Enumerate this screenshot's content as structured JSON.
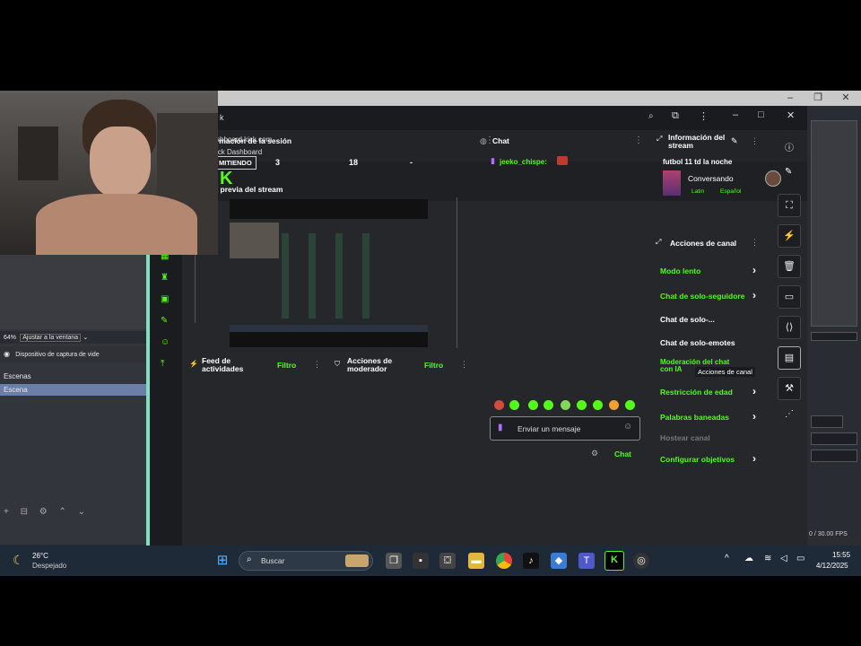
{
  "obs": {
    "window_controls": [
      "–",
      "❐",
      "✕"
    ],
    "zoom_label": "64%",
    "fit_label": "Ajustar a la ventana",
    "source_name": "Dispositivo de captura de vide",
    "scenes_header": "Escenas",
    "scene_selected": "Escena",
    "fps_label": "0 / 30.00 FPS"
  },
  "browser": {
    "tab_title": "k",
    "url_line1": "shboard.kick.com",
    "url_line2": "ick Dashboard",
    "window_controls": [
      "–",
      "□",
      "✕"
    ]
  },
  "dashboard": {
    "session_title": "rmación de la sesión",
    "status_badge": "MITIENDO",
    "stat_1": "3",
    "stat_2": "18",
    "stat_3": "-",
    "preview_title": "Vista previa del stream",
    "chat_title": "Chat",
    "chat_user": "jeeko_chispe:",
    "activity_feed_title": "Feed de actividades",
    "activity_filter": "Filtro",
    "mod_actions_title": "Acciones de moderador",
    "mod_filter": "Filtro",
    "message_placeholder": "Enviar un mensaje",
    "chat_send": "Chat",
    "stream_info_title": "Información del stream",
    "stream_name": "futbol 11 td la noche",
    "stream_category": "Conversando",
    "tag_1": "Latin",
    "tag_2": "Español",
    "channel_actions_title": "Acciones de canal",
    "channel_actions_tooltip": "Acciones de canal",
    "actions": [
      {
        "label": "Modo lento",
        "color": "green"
      },
      {
        "label": "Chat de solo-seguidore",
        "color": "green"
      },
      {
        "label": "Chat de solo-...",
        "color": "white"
      },
      {
        "label": "Chat de solo-emotes",
        "color": "white"
      },
      {
        "label": "Moderación del chat con IA",
        "color": "green"
      },
      {
        "label": "Restricción de edad",
        "color": "green"
      },
      {
        "label": "Palabras baneadas",
        "color": "green"
      },
      {
        "label": "Hostear canal",
        "color": "gray"
      },
      {
        "label": "Configurar objetivos",
        "color": "green"
      }
    ]
  },
  "taskbar": {
    "weather_temp": "26°C",
    "weather_desc": "Despejado",
    "search_placeholder": "Buscar",
    "time": "15:55",
    "date": "4/12/2025"
  },
  "colors": {
    "kick_green": "#53fc18",
    "accent_teal": "#7fe0c0",
    "taskbar": "#1f2a38"
  }
}
